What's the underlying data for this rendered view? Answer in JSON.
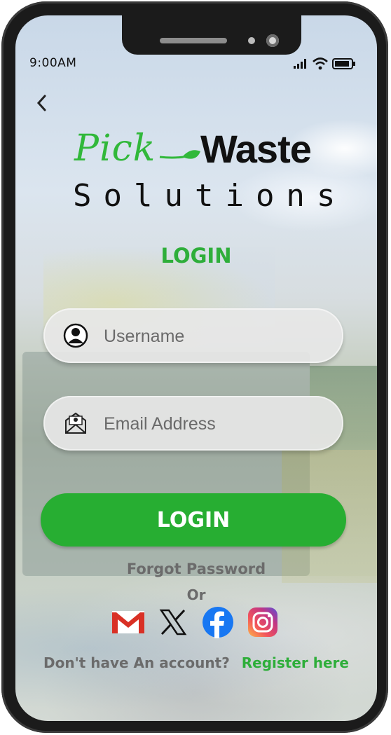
{
  "status_bar": {
    "time": "9:00AM"
  },
  "logo": {
    "pick": "Pick",
    "waste": "Waste",
    "solutions": "Solutions"
  },
  "page_title": "LOGIN",
  "form": {
    "username_placeholder": "Username",
    "email_placeholder": "Email Address",
    "login_button": "LOGIN"
  },
  "links": {
    "forgot_password": "Forgot Password",
    "or": "Or",
    "no_account": "Don't have An account?",
    "register": "Register here"
  },
  "social": [
    "gmail-icon",
    "x-icon",
    "facebook-icon",
    "instagram-icon"
  ],
  "colors": {
    "brand_green": "#27ae32",
    "text_gray": "#6b6b6b"
  }
}
